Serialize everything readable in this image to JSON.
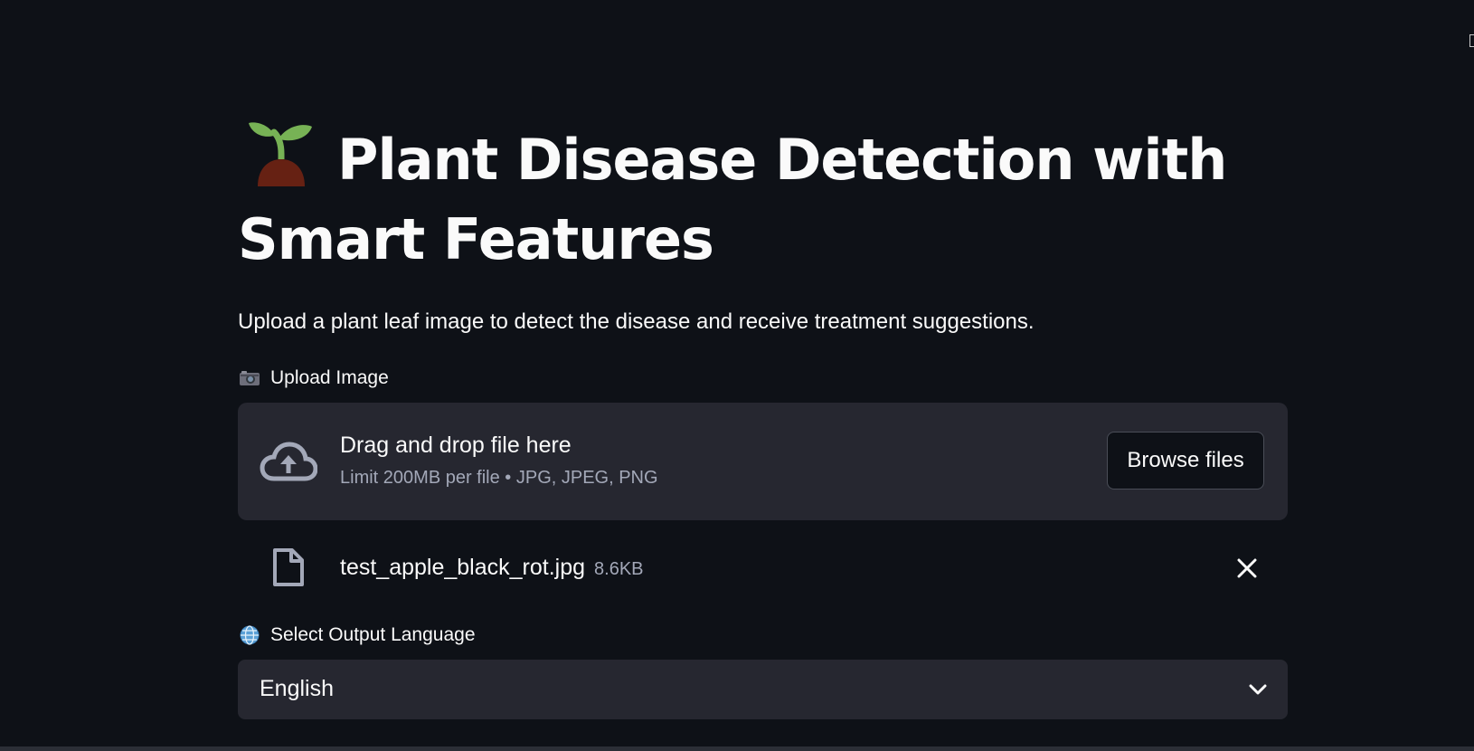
{
  "header": {
    "title_emoji": "seedling-icon",
    "title": "Plant Disease Detection with Smart Features",
    "subtitle": "Upload a plant leaf image to detect the disease and receive treatment suggestions."
  },
  "uploader": {
    "label": "Upload Image",
    "label_icon": "camera-icon",
    "drop_text": "Drag and drop file here",
    "limit_text": "Limit 200MB per file • JPG, JPEG, PNG",
    "browse_label": "Browse files"
  },
  "uploaded_file": {
    "name": "test_apple_black_rot.jpg",
    "size": "8.6KB"
  },
  "language": {
    "label": "Select Output Language",
    "label_icon": "globe-icon",
    "selected": "English"
  },
  "colors": {
    "background": "#0e1117",
    "panel": "#262730",
    "text": "#fafafa",
    "muted": "#a3a8b8"
  }
}
